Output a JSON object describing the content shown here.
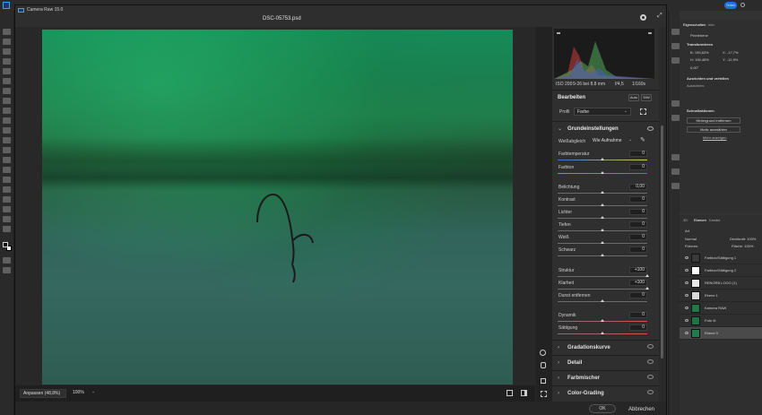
{
  "ps": {
    "share_label": "Teilen"
  },
  "dialog": {
    "title": "Camera Raw 15.0",
    "filename": "DSC-05753.psd"
  },
  "zoom": {
    "fit_label": "Anpassen (48,8%)",
    "percent_label": "100%"
  },
  "histogram": {
    "iso": "ISO 200",
    "lens": "9-26 bei 8.8 mm",
    "aperture": "f/4,5",
    "shutter": "1/160s"
  },
  "edit": {
    "title": "Bearbeiten",
    "auto_label": "Auto",
    "bw_label": "S/W",
    "profile_label": "Profil",
    "profile_value": "Farbe"
  },
  "basic": {
    "title": "Grundeinstellungen",
    "wb_label": "Weißabgleich",
    "wb_value": "Wie Aufnahme",
    "sliders": [
      {
        "label": "Farbtemperatur",
        "value": "0",
        "pos": 0.5
      },
      {
        "label": "Farbton",
        "value": "0",
        "pos": 0.5
      },
      {
        "label": "Belichtung",
        "value": "0,00",
        "pos": 0.5
      },
      {
        "label": "Kontrast",
        "value": "0",
        "pos": 0.5
      },
      {
        "label": "Lichter",
        "value": "0",
        "pos": 0.5
      },
      {
        "label": "Tiefen",
        "value": "0",
        "pos": 0.5
      },
      {
        "label": "Weiß",
        "value": "0",
        "pos": 0.5
      },
      {
        "label": "Schwarz",
        "value": "0",
        "pos": 0.5
      },
      {
        "label": "Struktur",
        "value": "+100",
        "pos": 1.0
      },
      {
        "label": "Klarheit",
        "value": "+100",
        "pos": 1.0
      },
      {
        "label": "Dunst entfernen",
        "value": "0",
        "pos": 0.5
      },
      {
        "label": "Dynamik",
        "value": "0",
        "pos": 0.5
      },
      {
        "label": "Sättigung",
        "value": "0",
        "pos": 0.5
      }
    ]
  },
  "sections": [
    "Gradationskurve",
    "Detail",
    "Farbmischer",
    "Color-Grading"
  ],
  "footer": {
    "ok_label": "OK",
    "cancel_label": "Abbrechen"
  },
  "props": {
    "tab1": "Eigenschaften",
    "tab2": "Info",
    "layer_type": "Pixelebene",
    "transform_title": "Transformieren",
    "w": "B: 155,83%",
    "h": "H: 155,48%",
    "x": "X: -17,7%",
    "y": "Y: -12,9%",
    "angle": "0,00°",
    "align_title": "Ausrichten und verteilen",
    "align_sub": "Ausrichten:",
    "quick_title": "Schnellaktionen",
    "qa1": "Hintergrund entfernen",
    "qa2": "Motiv auswählen",
    "qa_more": "Mehr anzeigen"
  },
  "layers": {
    "tab1": "Ebenen",
    "tab2": "Kanäle",
    "tab0": "3D",
    "search": "Art",
    "blend": "Normal",
    "opacity": "Deckkraft: 100%",
    "lock": "Fixieren:",
    "fill": "Fläche: 100%",
    "items": [
      {
        "name": "Farbton/Sättigung 1",
        "thumb": "#3a3a3a"
      },
      {
        "name": "Farbton/Sättigung 2",
        "thumb": "#ffffff"
      },
      {
        "name": "RENORB LOGO (1)",
        "thumb": "#e8e8e8"
      },
      {
        "name": "Ebene 1",
        "thumb": "#d8d8d8"
      },
      {
        "name": "Kamera RAW",
        "thumb": "#1f7a48"
      },
      {
        "name": "Foto 4t",
        "thumb": "#1e7445"
      },
      {
        "name": "Ebene 0",
        "thumb": "#237a4d"
      }
    ]
  }
}
